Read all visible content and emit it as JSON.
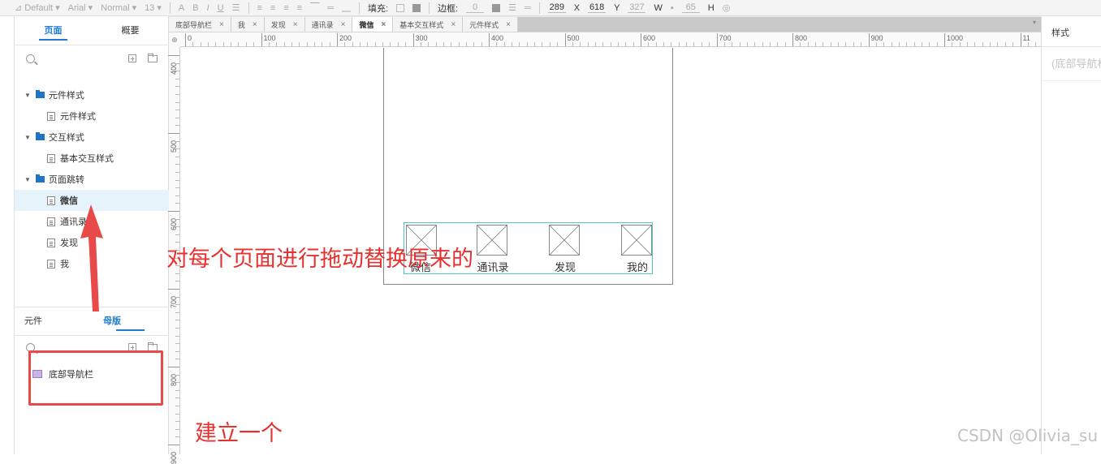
{
  "toolbar": {
    "style_select": "Default",
    "font_select": "Arial",
    "weight_select": "Normal",
    "size_select": "13",
    "fill_label": "填充:",
    "border_label": "边框:",
    "border_value": "0",
    "x_value": "289",
    "x_label": "X",
    "y_value": "618",
    "y_label": "Y",
    "w_value": "327",
    "w_label": "W",
    "h_value": "65",
    "h_label": "H"
  },
  "pages_panel": {
    "tabs": [
      "页面",
      "概要"
    ],
    "active_tab": "页面",
    "tree": [
      {
        "type": "folder",
        "label": "元件样式"
      },
      {
        "type": "page",
        "label": "元件样式"
      },
      {
        "type": "folder",
        "label": "交互样式"
      },
      {
        "type": "page",
        "label": "基本交互样式"
      },
      {
        "type": "folder",
        "label": "页面跳转"
      },
      {
        "type": "page",
        "label": "微信",
        "selected": true
      },
      {
        "type": "page",
        "label": "通讯录"
      },
      {
        "type": "page",
        "label": "发现"
      },
      {
        "type": "page",
        "label": "我"
      }
    ]
  },
  "masters_panel": {
    "tabs": [
      "元件",
      "母版"
    ],
    "active_tab": "母版",
    "items": [
      {
        "label": "底部导航栏"
      }
    ]
  },
  "doc_tabs": [
    {
      "label": "底部导航栏",
      "active": false
    },
    {
      "label": "我",
      "active": false
    },
    {
      "label": "发现",
      "active": false
    },
    {
      "label": "通讯录",
      "active": false
    },
    {
      "label": "微信",
      "active": true
    },
    {
      "label": "基本交互样式",
      "active": false
    },
    {
      "label": "元件样式",
      "active": false
    }
  ],
  "ruler_h": [
    "0",
    "100",
    "200",
    "300",
    "400",
    "500",
    "600",
    "700",
    "800",
    "900",
    "1000",
    "11"
  ],
  "ruler_v": [
    "400",
    "500",
    "600",
    "700",
    "800",
    "900"
  ],
  "nav_bar": {
    "items": [
      "微信",
      "通讯录",
      "发现",
      "我的"
    ]
  },
  "annotations": {
    "main": "对每个页面进行拖动替换原来的",
    "secondary": "建立一个"
  },
  "right_panel": {
    "title": "样式",
    "subtitle": "(底部导航栏)"
  },
  "watermark": "CSDN @Olivia_su",
  "colors": {
    "accent": "#1e7bd6",
    "annotation_red": "#e8312f",
    "nav_outline": "#52c6c9",
    "selected_row": "#e6f3fb"
  }
}
